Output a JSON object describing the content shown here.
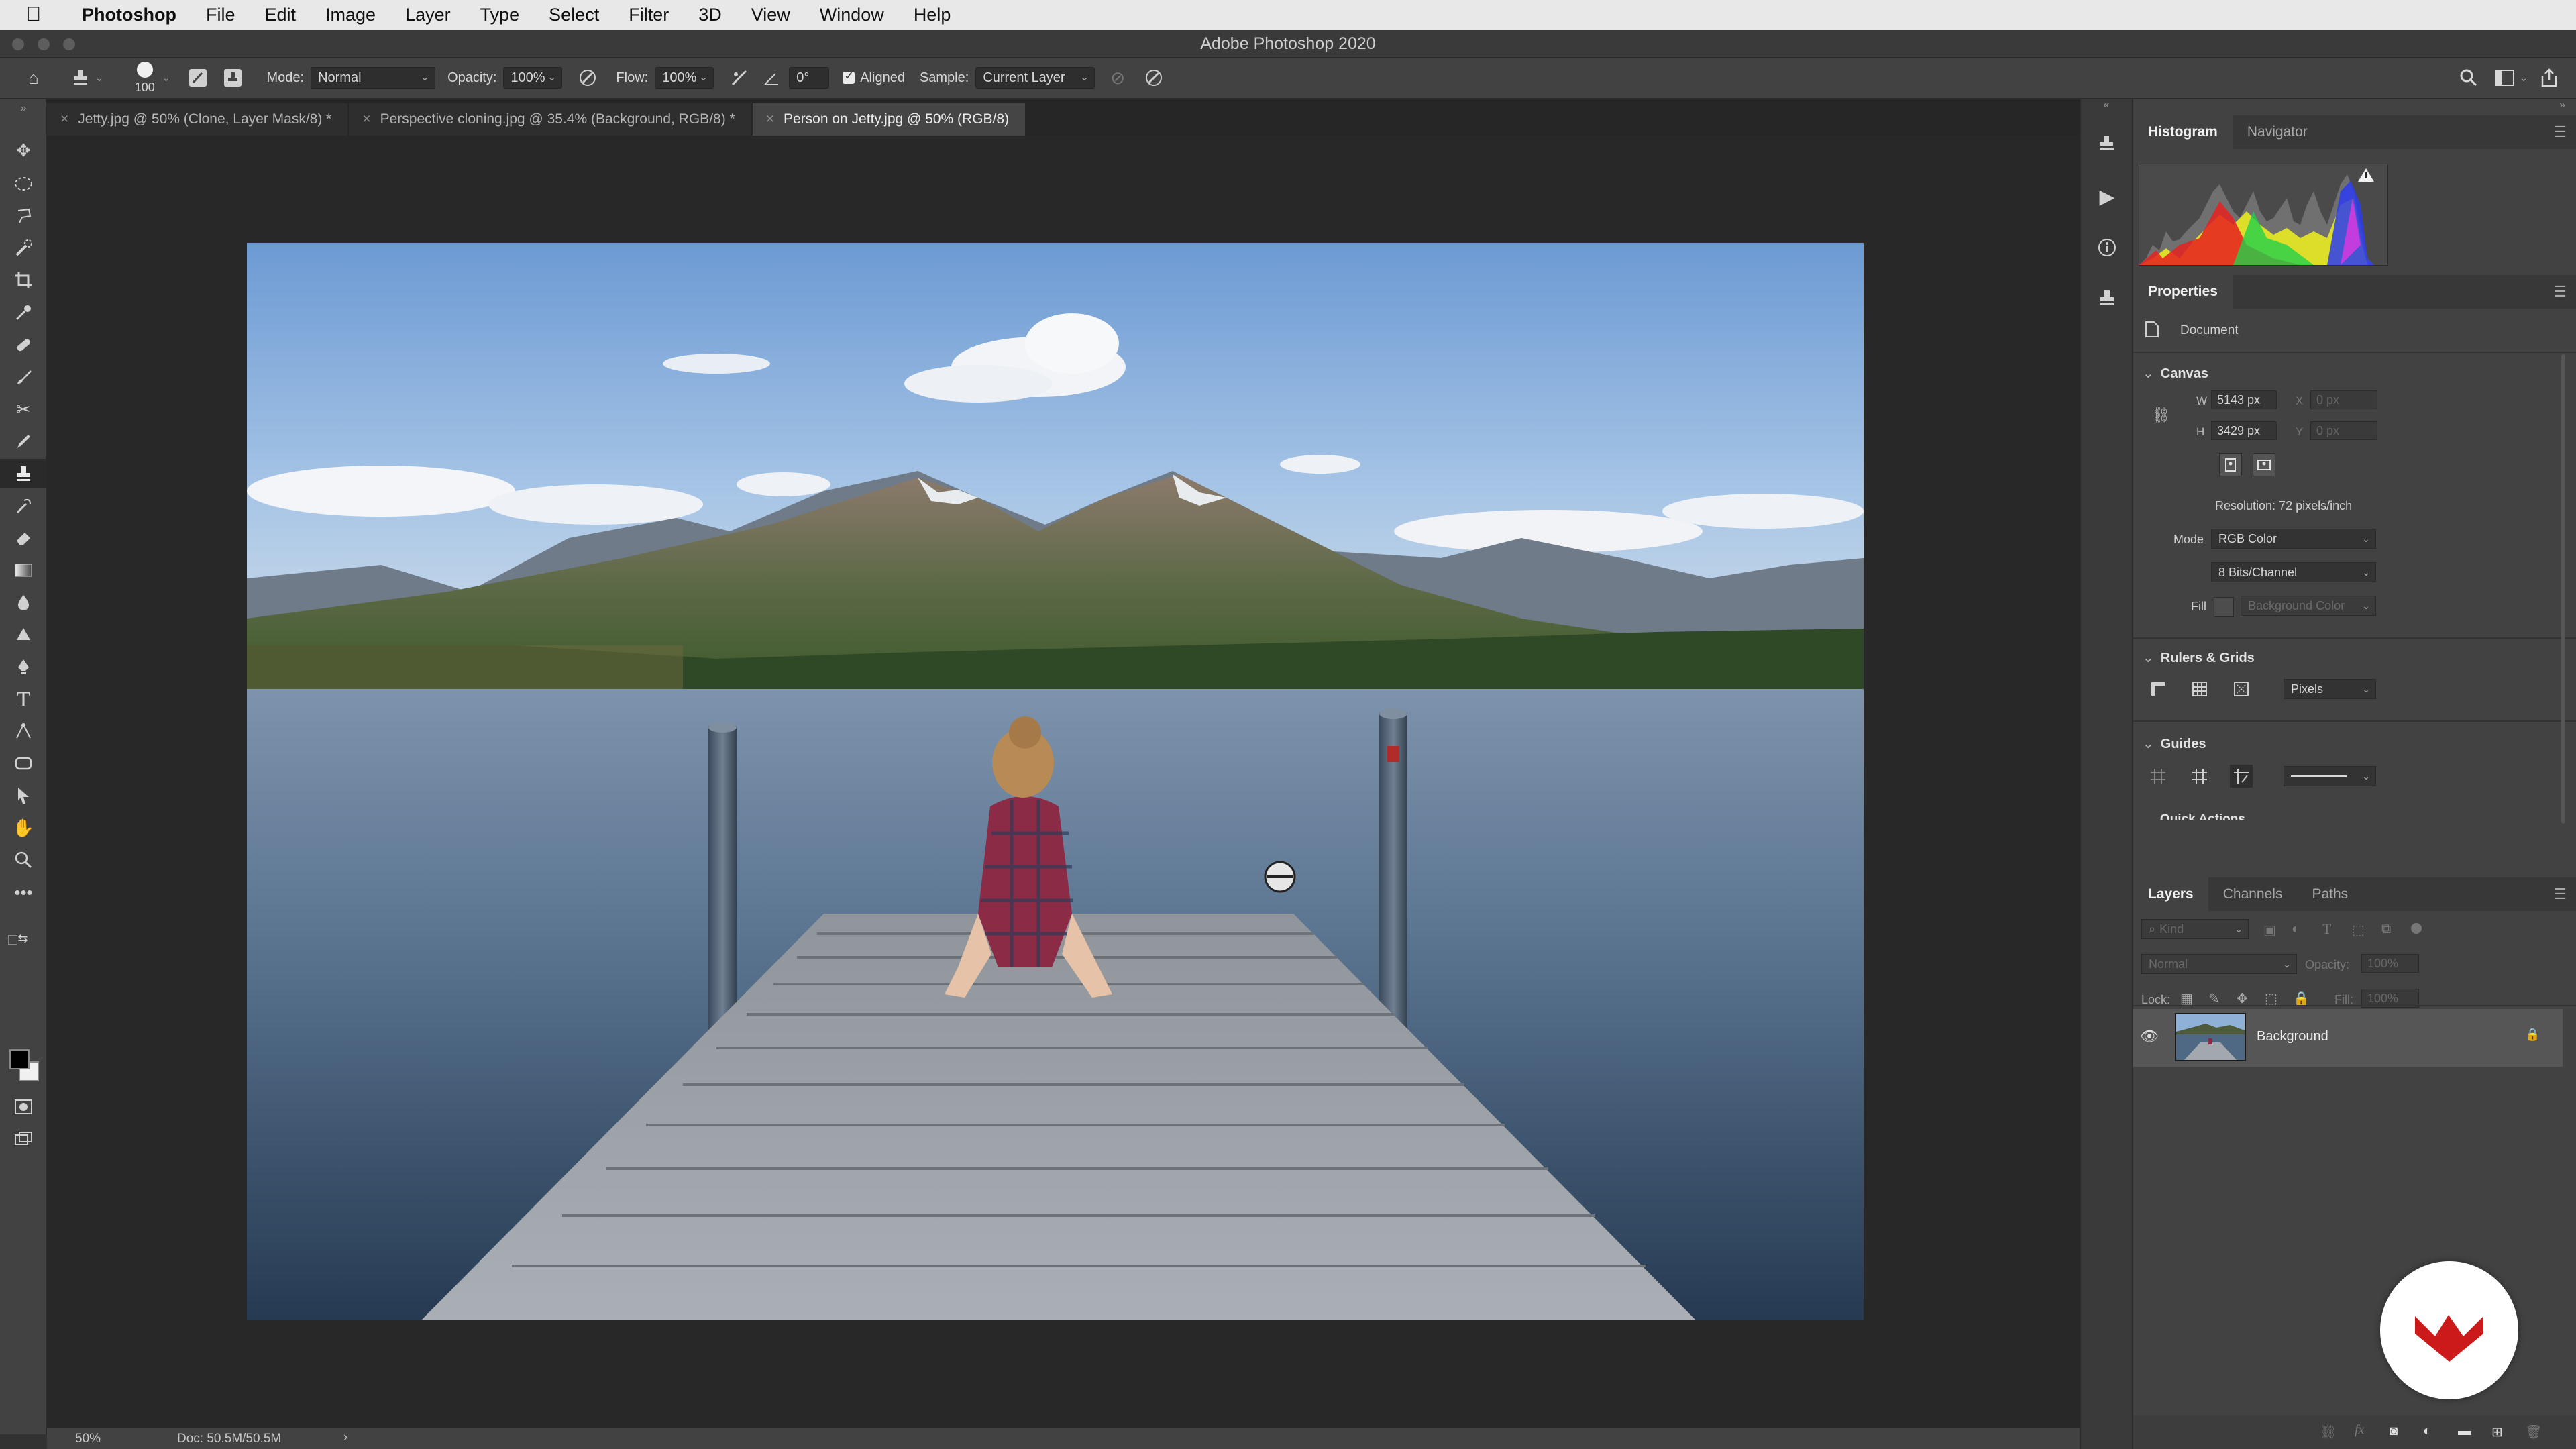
{
  "menubar": {
    "apple_icon": "apple-icon",
    "items": [
      "Photoshop",
      "File",
      "Edit",
      "Image",
      "Layer",
      "Type",
      "Select",
      "Filter",
      "3D",
      "View",
      "Window",
      "Help"
    ]
  },
  "window": {
    "title": "Adobe Photoshop 2020"
  },
  "options_bar": {
    "brush_size": "100",
    "mode_label": "Mode:",
    "mode_value": "Normal",
    "opacity_label": "Opacity:",
    "opacity_value": "100%",
    "flow_label": "Flow:",
    "flow_value": "100%",
    "angle_value": "0°",
    "aligned_label": "Aligned",
    "sample_label": "Sample:",
    "sample_value": "Current Layer"
  },
  "tabs": [
    {
      "label": "Jetty.jpg @ 50% (Clone, Layer Mask/8) *",
      "active": false
    },
    {
      "label": "Perspective cloning.jpg @ 35.4% (Background, RGB/8) *",
      "active": false
    },
    {
      "label": "Person on Jetty.jpg @ 50% (RGB/8)",
      "active": true
    }
  ],
  "status": {
    "zoom": "50%",
    "doc": "Doc: 50.5M/50.5M",
    "arrow": "›"
  },
  "histogram_panel": {
    "tabs": [
      "Histogram",
      "Navigator"
    ]
  },
  "properties_panel": {
    "title": "Properties",
    "doc_label": "Document",
    "canvas_header": "Canvas",
    "w_label": "W",
    "w_value": "5143 px",
    "h_label": "H",
    "h_value": "3429 px",
    "x_label": "X",
    "x_value": "0 px",
    "y_label": "Y",
    "y_value": "0 px",
    "resolution": "Resolution: 72 pixels/inch",
    "mode_label": "Mode",
    "mode_value": "RGB Color",
    "bits_value": "8 Bits/Channel",
    "fill_label": "Fill",
    "fill_value": "Background Color",
    "rulers_header": "Rulers & Grids",
    "units_value": "Pixels",
    "guides_header": "Guides",
    "quick_actions_header": "Quick Actions"
  },
  "layers_panel": {
    "tabs": [
      "Layers",
      "Channels",
      "Paths"
    ],
    "filter_placeholder": "Kind",
    "blend_mode": "Normal",
    "opacity_label": "Opacity:",
    "opacity_value": "100%",
    "lock_label": "Lock:",
    "fill_label": "Fill:",
    "fill_value": "100%",
    "layers": [
      {
        "name": "Background",
        "visible": true,
        "locked": true
      }
    ]
  },
  "colors": {
    "menubar_bg": "#e8e8e8",
    "panel_bg": "#424242",
    "canvas_bg": "#282828",
    "logo_red": "#cc1a1a"
  }
}
